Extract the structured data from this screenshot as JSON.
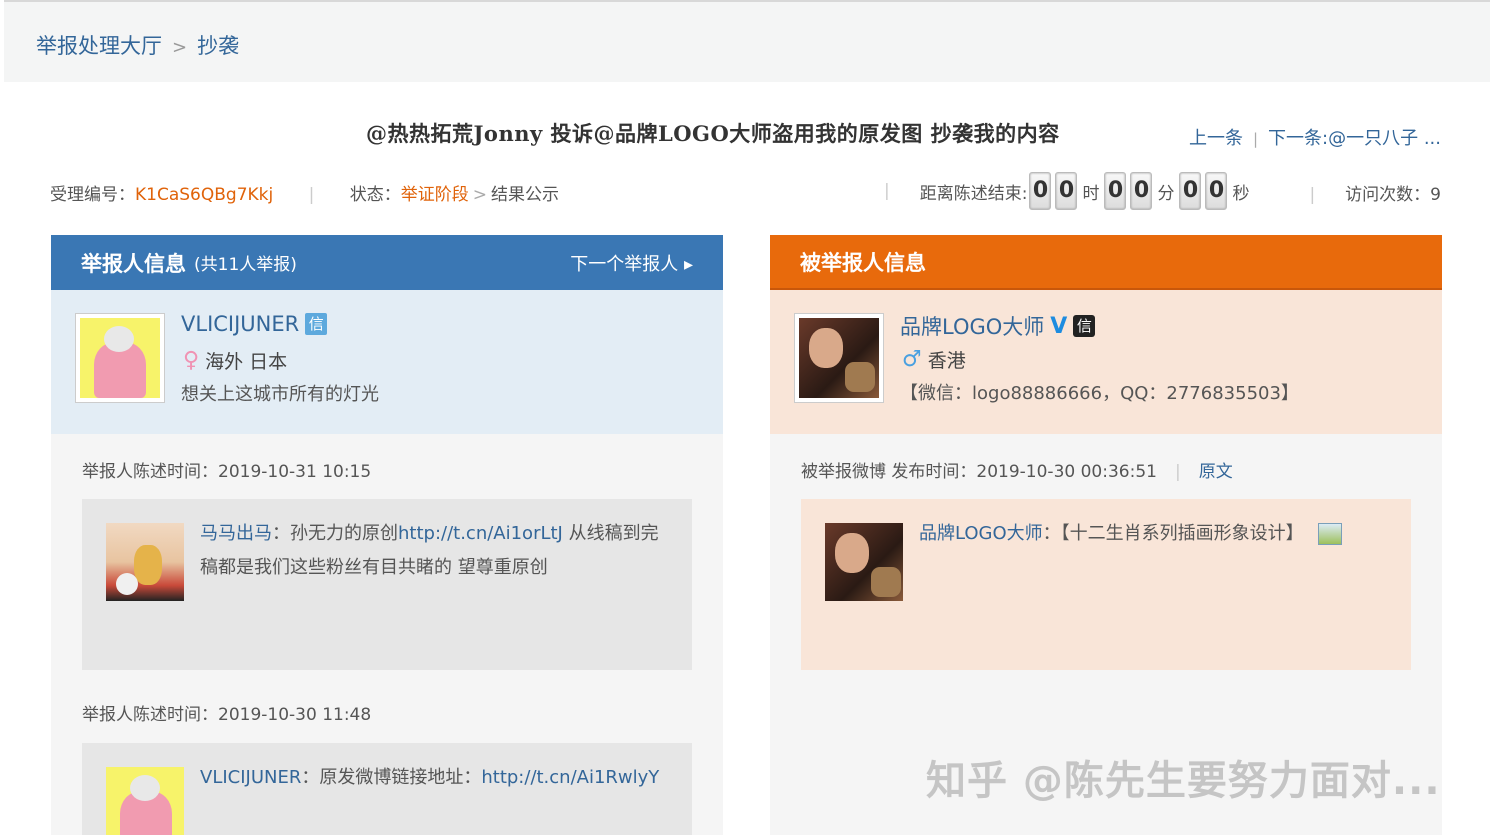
{
  "breadcrumb": {
    "home": "举报处理大厅",
    "separator": ">",
    "current": "抄袭"
  },
  "title": "@热热拓荒Jonny 投诉@品牌LOGO大师盗用我的原发图 抄袭我的内容",
  "nav": {
    "prev": "上一条",
    "divider": "|",
    "next": "下一条:@一只八子 ..."
  },
  "meta": {
    "case_label": "受理编号：",
    "case_id": "K1CaS6QBg7Kkj",
    "status_label": "状态：",
    "status_current": "举证阶段",
    "status_arrow": ">",
    "status_next": "结果公示"
  },
  "countdown": {
    "label": "距离陈述结束:",
    "h1": "0",
    "h2": "0",
    "h_unit": "时",
    "m1": "0",
    "m2": "0",
    "m_unit": "分",
    "s1": "0",
    "s2": "0",
    "s_unit": "秒"
  },
  "visits": {
    "label": "访问次数：",
    "count": "9"
  },
  "reporter": {
    "header_title": "举报人信息",
    "header_sub": "(共11人举报)",
    "next_reporter": "下一个举报人 ▸",
    "name": "VLICIJUNER",
    "badge": "信",
    "gender_icon": "♀",
    "location": "海外 日本",
    "bio": "想关上这城市所有的灯光",
    "statements": [
      {
        "time_label": "举报人陈述时间：2019-10-31 10:15",
        "author": "马马出马",
        "colon": "：",
        "text_before": "孙无力的原创",
        "link": "http://t.cn/Ai1orLtJ",
        "text_after": " 从线稿到完稿都是我们这些粉丝有目共睹的 望尊重原创"
      },
      {
        "time_label": "举报人陈述时间：2019-10-30 11:48",
        "author": "VLICIJUNER",
        "colon": "：",
        "text_before": "原发微博链接地址：",
        "link": "http://t.cn/Ai1RwlyY",
        "text_after": ""
      }
    ]
  },
  "reported": {
    "header_title": "被举报人信息",
    "name": "品牌LOGO大师",
    "badge_v": "V",
    "badge_xin": "信",
    "gender_icon": "♂",
    "location": "香港",
    "contact": "【微信：logo88886666，QQ：2776835503】",
    "post_label": "被举报微博 发布时间：2019-10-30 00:36:51",
    "post_divider": "|",
    "original_link": "原文",
    "post_author": "品牌LOGO大师",
    "post_colon": "：",
    "post_text": "【十二生肖系列插画形象设计】"
  },
  "watermark": "知乎 @陈先生要努力面对..."
}
